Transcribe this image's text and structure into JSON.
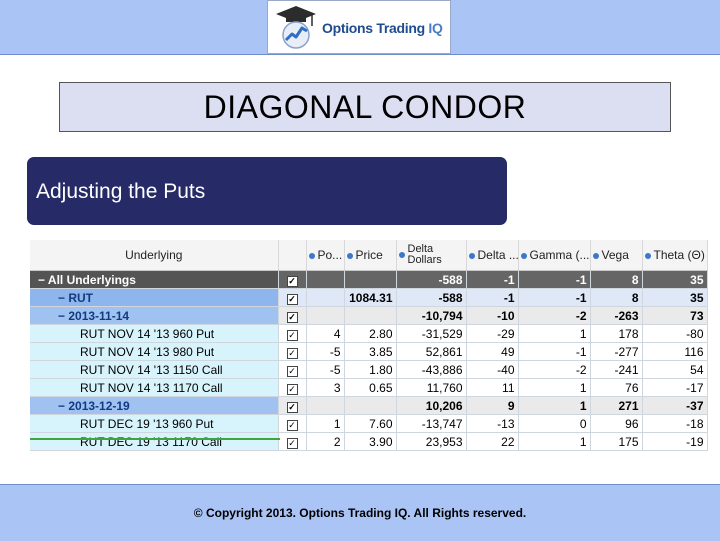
{
  "logo": {
    "text_main": "Options Trading ",
    "text_accent": "IQ"
  },
  "title": "DIAGONAL CONDOR",
  "subtitle": "Adjusting the Puts",
  "table": {
    "headers": {
      "underlying": "Underlying",
      "po": "Po...",
      "price": "Price",
      "delta_dollars_1": "Delta",
      "delta_dollars_2": "Dollars",
      "delta": "Delta ...",
      "gamma": "Gamma (...",
      "vega": "Vega",
      "theta": "Theta (Θ)"
    },
    "rows": [
      {
        "type": "all",
        "indent": 1,
        "name": "− All Underlyings",
        "checked": "✓",
        "po": "",
        "price": "",
        "delta_dollars": "-588",
        "delta": "-1",
        "gamma": "-1",
        "vega": "8",
        "theta": "35"
      },
      {
        "type": "rut",
        "indent": 2,
        "name": "− RUT",
        "checked": "✓",
        "po": "",
        "price": "1084.31",
        "delta_dollars": "-588",
        "delta": "-1",
        "gamma": "-1",
        "vega": "8",
        "theta": "35"
      },
      {
        "type": "date",
        "indent": 2,
        "name": "− 2013-11-14",
        "checked": "✓",
        "po": "",
        "price": "",
        "delta_dollars": "-10,794",
        "delta": "-10",
        "gamma": "-2",
        "vega": "-263",
        "theta": "73"
      },
      {
        "type": "pos",
        "indent": 3,
        "name": "RUT NOV 14 '13 960 Put",
        "checked": "✓",
        "po": "4",
        "price": "2.80",
        "delta_dollars": "-31,529",
        "delta": "-29",
        "gamma": "1",
        "vega": "178",
        "theta": "-80"
      },
      {
        "type": "pos",
        "indent": 3,
        "name": "RUT NOV 14 '13 980 Put",
        "checked": "✓",
        "po": "-5",
        "price": "3.85",
        "delta_dollars": "52,861",
        "delta": "49",
        "gamma": "-1",
        "vega": "-277",
        "theta": "116"
      },
      {
        "type": "pos",
        "indent": 3,
        "name": "RUT NOV 14 '13 1150 Call",
        "checked": "✓",
        "po": "-5",
        "price": "1.80",
        "delta_dollars": "-43,886",
        "delta": "-40",
        "gamma": "-2",
        "vega": "-241",
        "theta": "54"
      },
      {
        "type": "pos",
        "indent": 3,
        "name": "RUT NOV 14 '13 1170 Call",
        "checked": "✓",
        "po": "3",
        "price": "0.65",
        "delta_dollars": "11,760",
        "delta": "11",
        "gamma": "1",
        "vega": "76",
        "theta": "-17"
      },
      {
        "type": "date",
        "indent": 2,
        "name": "− 2013-12-19",
        "checked": "✓",
        "po": "",
        "price": "",
        "delta_dollars": "10,206",
        "delta": "9",
        "gamma": "1",
        "vega": "271",
        "theta": "-37"
      },
      {
        "type": "pos",
        "indent": 3,
        "name": "RUT DEC 19 '13 960 Put",
        "checked": "✓",
        "po": "1",
        "price": "7.60",
        "delta_dollars": "-13,747",
        "delta": "-13",
        "gamma": "0",
        "vega": "96",
        "theta": "-18"
      },
      {
        "type": "pos",
        "indent": 3,
        "name": "RUT DEC 19 '13 1170 Call",
        "checked": "✓",
        "po": "2",
        "price": "3.90",
        "delta_dollars": "23,953",
        "delta": "22",
        "gamma": "1",
        "vega": "175",
        "theta": "-19"
      }
    ]
  },
  "footer": "© Copyright 2013. Options Trading IQ. All Rights reserved.",
  "colors": {
    "band": "#a9c4f5",
    "subtitle_bg": "#262a66",
    "title_bg": "#dcdff2"
  }
}
